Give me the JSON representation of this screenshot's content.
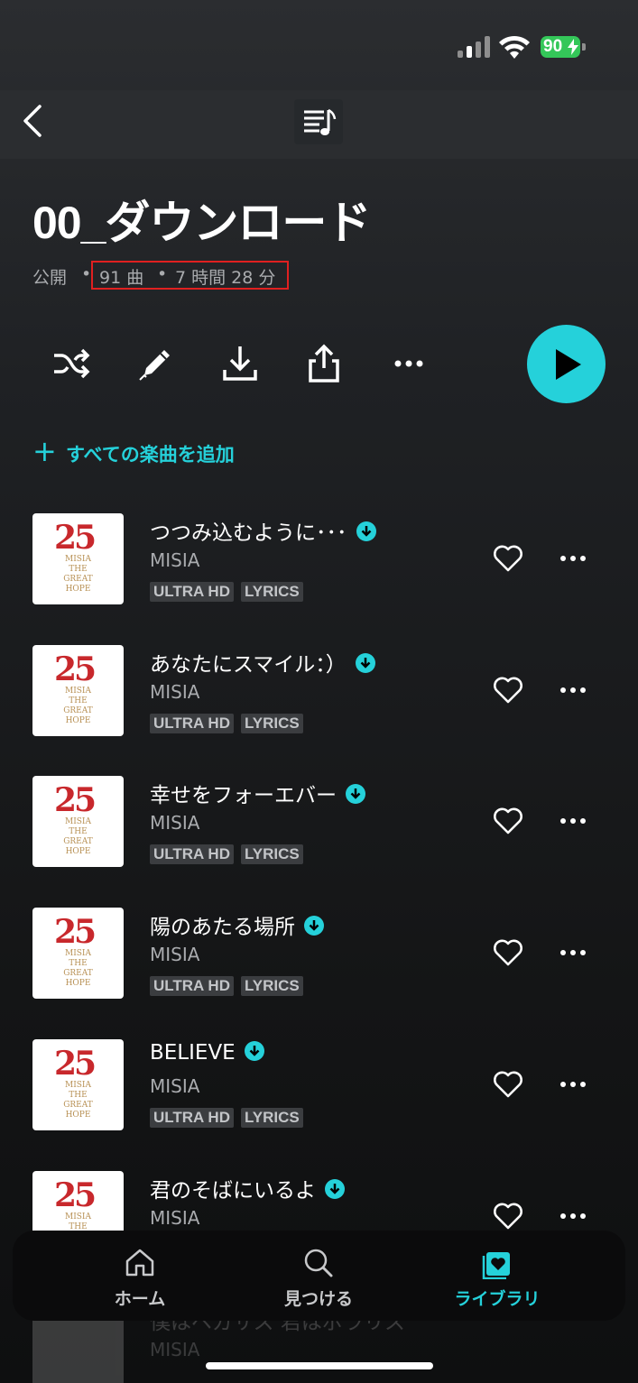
{
  "status_bar": {
    "battery": "90"
  },
  "header": {
    "back_icon": "chevron-left-icon",
    "center_icon": "playlist-music-icon"
  },
  "playlist": {
    "title": "00_ダウンロード",
    "visibility": "公開",
    "separator": "•",
    "track_count": "91 曲",
    "duration": "7 時間 28 分"
  },
  "actions": {
    "icons": [
      "shuffle-icon",
      "pencil-icon",
      "download-icon",
      "share-icon",
      "more-horizontal-icon"
    ],
    "play_icon": "play-icon",
    "play_color": "#25d1da"
  },
  "add_all": {
    "label": "すべての楽曲を追加"
  },
  "tracks": [
    {
      "title": "つつみ込むように･･･",
      "artist": "MISIA",
      "badges": [
        "ULTRA HD",
        "LYRICS"
      ]
    },
    {
      "title": "あなたにスマイル：）",
      "artist": "MISIA",
      "badges": [
        "ULTRA HD",
        "LYRICS"
      ]
    },
    {
      "title": "幸せをフォーエバー",
      "artist": "MISIA",
      "badges": [
        "ULTRA HD",
        "LYRICS"
      ]
    },
    {
      "title": "陽のあたる場所",
      "artist": "MISIA",
      "badges": [
        "ULTRA HD",
        "LYRICS"
      ]
    },
    {
      "title": "BELIEVE",
      "artist": "MISIA",
      "badges": [
        "ULTRA HD",
        "LYRICS"
      ]
    },
    {
      "title": "君のそばにいるよ",
      "artist": "MISIA",
      "badges": []
    }
  ],
  "album_art": {
    "number": "25",
    "lines": [
      "MISIA",
      "THE",
      "GREAT",
      "HOPE"
    ]
  },
  "tab_bar": {
    "tabs": [
      {
        "label": "ホーム",
        "icon": "home-icon"
      },
      {
        "label": "見つける",
        "icon": "search-icon"
      },
      {
        "label": "ライブラリ",
        "icon": "library-heart-icon"
      }
    ],
    "active": "ライブラリ",
    "accent": "#25d1da"
  },
  "ghost_row": {
    "title": "僕はペガサス 君はポラリス",
    "artist": "MISIA"
  }
}
